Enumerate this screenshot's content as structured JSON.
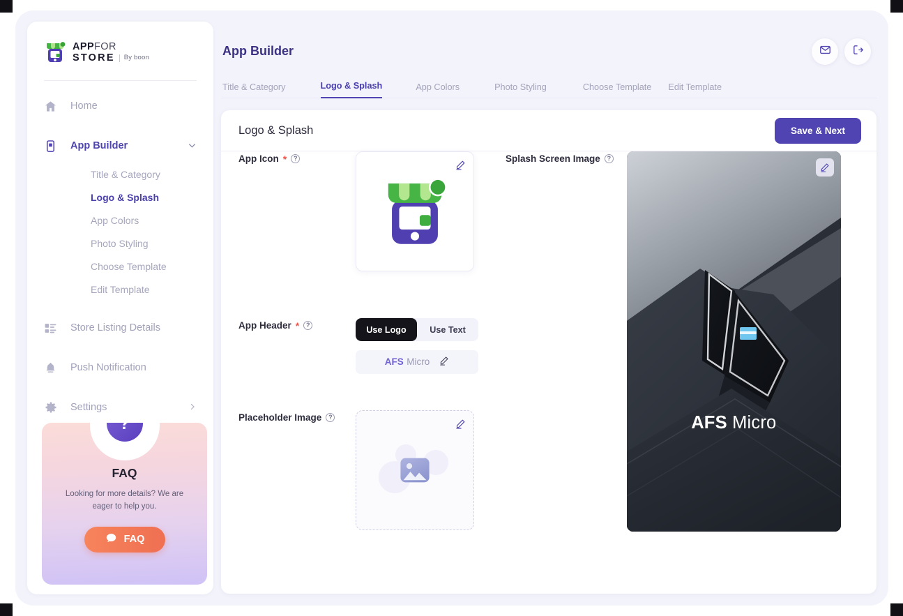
{
  "brand": {
    "line1_bold": "APP",
    "line1_light": "FOR",
    "line2": "STORE",
    "byline": "By boon",
    "logo_icon": "store-app-logo-icon"
  },
  "sidebar": {
    "items": [
      {
        "label": "Home",
        "icon": "home-icon",
        "active": false
      },
      {
        "label": "App Builder",
        "icon": "app-builder-icon",
        "active": true,
        "caret": "chevron-down-icon"
      },
      {
        "label": "Store Listing Details",
        "icon": "list-details-icon",
        "active": false
      },
      {
        "label": "Push Notification",
        "icon": "bell-icon",
        "active": false
      },
      {
        "label": "Settings",
        "icon": "gear-icon",
        "active": false,
        "caret": "chevron-right-icon"
      }
    ],
    "subitems": [
      {
        "label": "Title & Category",
        "active": false
      },
      {
        "label": "Logo & Splash",
        "active": true
      },
      {
        "label": "App Colors",
        "active": false
      },
      {
        "label": "Photo Styling",
        "active": false
      },
      {
        "label": "Choose Template",
        "active": false
      },
      {
        "label": "Edit Template",
        "active": false
      }
    ]
  },
  "faq": {
    "badge": "?",
    "title": "FAQ",
    "subtitle": "Looking for more details? We are eager to help you.",
    "button_label": "FAQ",
    "button_icon": "chat-bubble-icon"
  },
  "header": {
    "title": "App Builder",
    "mail_icon": "mail-icon",
    "logout_icon": "logout-icon"
  },
  "tabs": [
    {
      "label": "Title & Category",
      "active": false
    },
    {
      "label": "Logo & Splash",
      "active": true
    },
    {
      "label": "App Colors",
      "active": false
    },
    {
      "label": "Photo Styling",
      "active": false
    },
    {
      "label": "Choose Template",
      "active": false
    },
    {
      "label": "Edit Template",
      "active": false
    }
  ],
  "card": {
    "title": "Logo & Splash",
    "save_label": "Save & Next"
  },
  "fields": {
    "app_icon": {
      "label": "App Icon",
      "required": "*",
      "help_icon": "question-mark-icon",
      "edit_icon": "pencil-icon",
      "image": "store-app-icon-green-purple"
    },
    "app_header": {
      "label": "App Header",
      "required": "*",
      "help_icon": "question-mark-icon",
      "options": [
        {
          "label": "Use Logo",
          "selected": true
        },
        {
          "label": "Use Text",
          "selected": false
        }
      ],
      "logo_bold": "AFS",
      "logo_light": "Micro",
      "edit_icon": "pencil-icon"
    },
    "placeholder_image": {
      "label": "Placeholder Image",
      "required": "",
      "help_icon": "question-mark-icon",
      "edit_icon": "pencil-icon",
      "image": "image-placeholder-icon"
    },
    "splash_screen": {
      "label": "Splash Screen Image",
      "required": "",
      "help_icon": "question-mark-icon",
      "edit_icon": "pencil-icon",
      "overlay_bold": "AFS",
      "overlay_light": "Micro",
      "image": "dark-polo-shirt-photo"
    }
  },
  "colors": {
    "accent": "#4f44b1",
    "accent_text": "#4a3fae",
    "muted_text": "#a3a3bb",
    "required_star": "#f0544c",
    "page_bg": "#f3f3fb",
    "toggle_on_bg": "#15141a",
    "faq_button": "#ef6f52"
  }
}
